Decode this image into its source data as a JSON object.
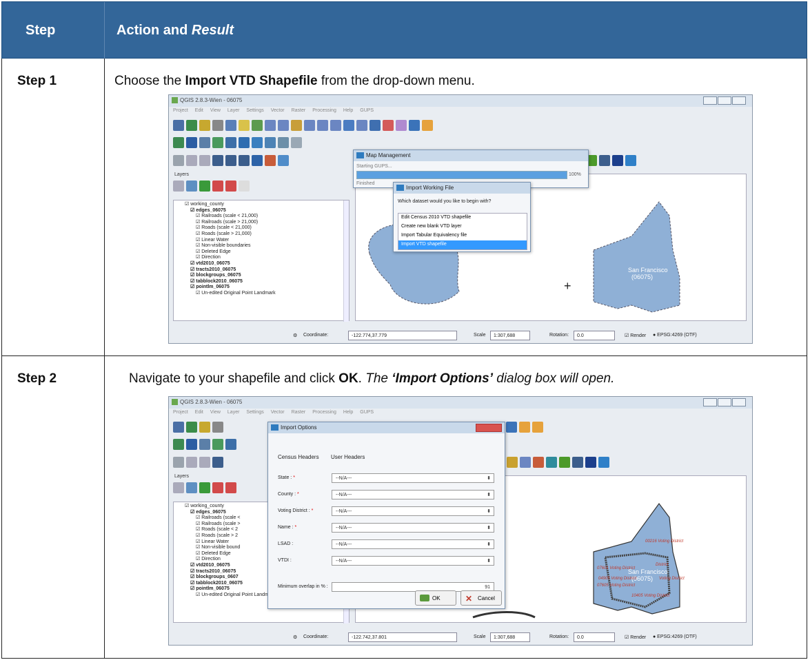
{
  "header": {
    "col1": "Step",
    "col2_prefix": "Action and ",
    "col2_italic": "Result"
  },
  "steps": [
    {
      "label": "Step 1",
      "text_prefix": "Choose the ",
      "text_bold": "Import VTD Shapefile",
      "text_suffix": " from the drop-down menu."
    },
    {
      "label": "Step 2",
      "text_prefix": "Navigate to your shapefile and click ",
      "text_bold": "OK",
      "text_mid": ". ",
      "text_italic1": "The ",
      "text_bold_italic": "‘Import Options’",
      "text_italic2": " dialog box will open."
    }
  ],
  "screenshot1": {
    "window_title": "QGIS 2.8.3-Wien - 06075",
    "menu": [
      "Project",
      "Edit",
      "View",
      "Layer",
      "Settings",
      "Vector",
      "Raster",
      "Processing",
      "Help",
      "GUPS"
    ],
    "layers_title": "Layers",
    "tree": [
      "working_county",
      "edges_06075",
      "Railroads (scale < 21,000)",
      "Railroads (scale > 21,000)",
      "Roads (scale < 21,000)",
      "Roads (scale > 21,000)",
      "Linear Water",
      "Non-visible boundaries",
      "Deleted Edge",
      "Direction",
      "vtd2010_06075",
      "tracts2010_06075",
      "blockgroups_06075",
      "tabblock2010_06075",
      "pointlm_06075",
      "Un-edited Original Point Landmark"
    ],
    "map_management": {
      "title": "Map Management",
      "status": "Starting GUPS...",
      "progress_label": "100%",
      "progress_value": 1.0,
      "finished": "Finished"
    },
    "import_working_file": {
      "title": "Import Working File",
      "question": "Which dataset would you like to begin with?",
      "options": [
        "Edit Census 2010 VTD shapefile",
        "Create new blank VTD layer",
        "Import Tabular Equivalency file",
        "Import VTD shapefile"
      ],
      "selected": "Import VTD shapefile"
    },
    "map_label": "San Francisco\n(06075)",
    "status": {
      "coordinate_label": "Coordinate:",
      "coordinate": "-122.774,37.779",
      "scale_label": "Scale",
      "scale": "1:307,688",
      "rotation_label": "Rotation:",
      "rotation": "0.0",
      "render": "Render",
      "crs": "EPSG:4269 (OTF)"
    }
  },
  "screenshot2": {
    "window_title": "QGIS 2.8.3-Wien - 06075",
    "menu": [
      "Project",
      "Edit",
      "View",
      "Layer",
      "Settings",
      "Vector",
      "Raster",
      "Processing",
      "Help",
      "GUPS"
    ],
    "layers_title": "Layers",
    "tree": [
      "working_county",
      "edges_06075",
      "Railroads (scale <",
      "Railroads (scale >",
      "Roads (scale < 2",
      "Roads (scale > 2",
      "Linear Water",
      "Non-visible bound",
      "Deleted Edge",
      "Direction",
      "vtd2010_06075",
      "tracts2010_06075",
      "blockgroups_0607",
      "tabblock2010_06075",
      "pointlm_06075",
      "Un-edited Original Point Landmark"
    ],
    "import_options": {
      "title": "Import Options",
      "col_census": "Census Headers",
      "col_user": "User Headers",
      "fields": [
        {
          "label": "State :",
          "value": "--N/A---",
          "required": true
        },
        {
          "label": "County :",
          "value": "--N/A---",
          "required": true
        },
        {
          "label": "Voting District :",
          "value": "--N/A---",
          "required": true
        },
        {
          "label": "Name :",
          "value": "--N/A---",
          "required": true
        },
        {
          "label": "LSAD :",
          "value": "--N/A---",
          "required": false
        },
        {
          "label": "VTDI :",
          "value": "--N/A---",
          "required": false
        }
      ],
      "overlap_label": "Minimum overlap in % :",
      "overlap_value": "91",
      "ok": "OK",
      "cancel": "Cancel"
    },
    "map_label": "San Francisco\n(06075)",
    "district_labels": [
      "00216 Voting District",
      "07601 Voting District",
      "District",
      "04905 Voting District",
      "Voting District",
      "07605 Voting District",
      "10405 Voting District"
    ],
    "status": {
      "coordinate_label": "Coordinate:",
      "coordinate": "-122.742,37.801",
      "scale_label": "Scale",
      "scale": "1:307,688",
      "rotation_label": "Rotation:",
      "rotation": "0.0",
      "render": "Render",
      "crs": "EPSG:4269 (OTF)"
    }
  }
}
